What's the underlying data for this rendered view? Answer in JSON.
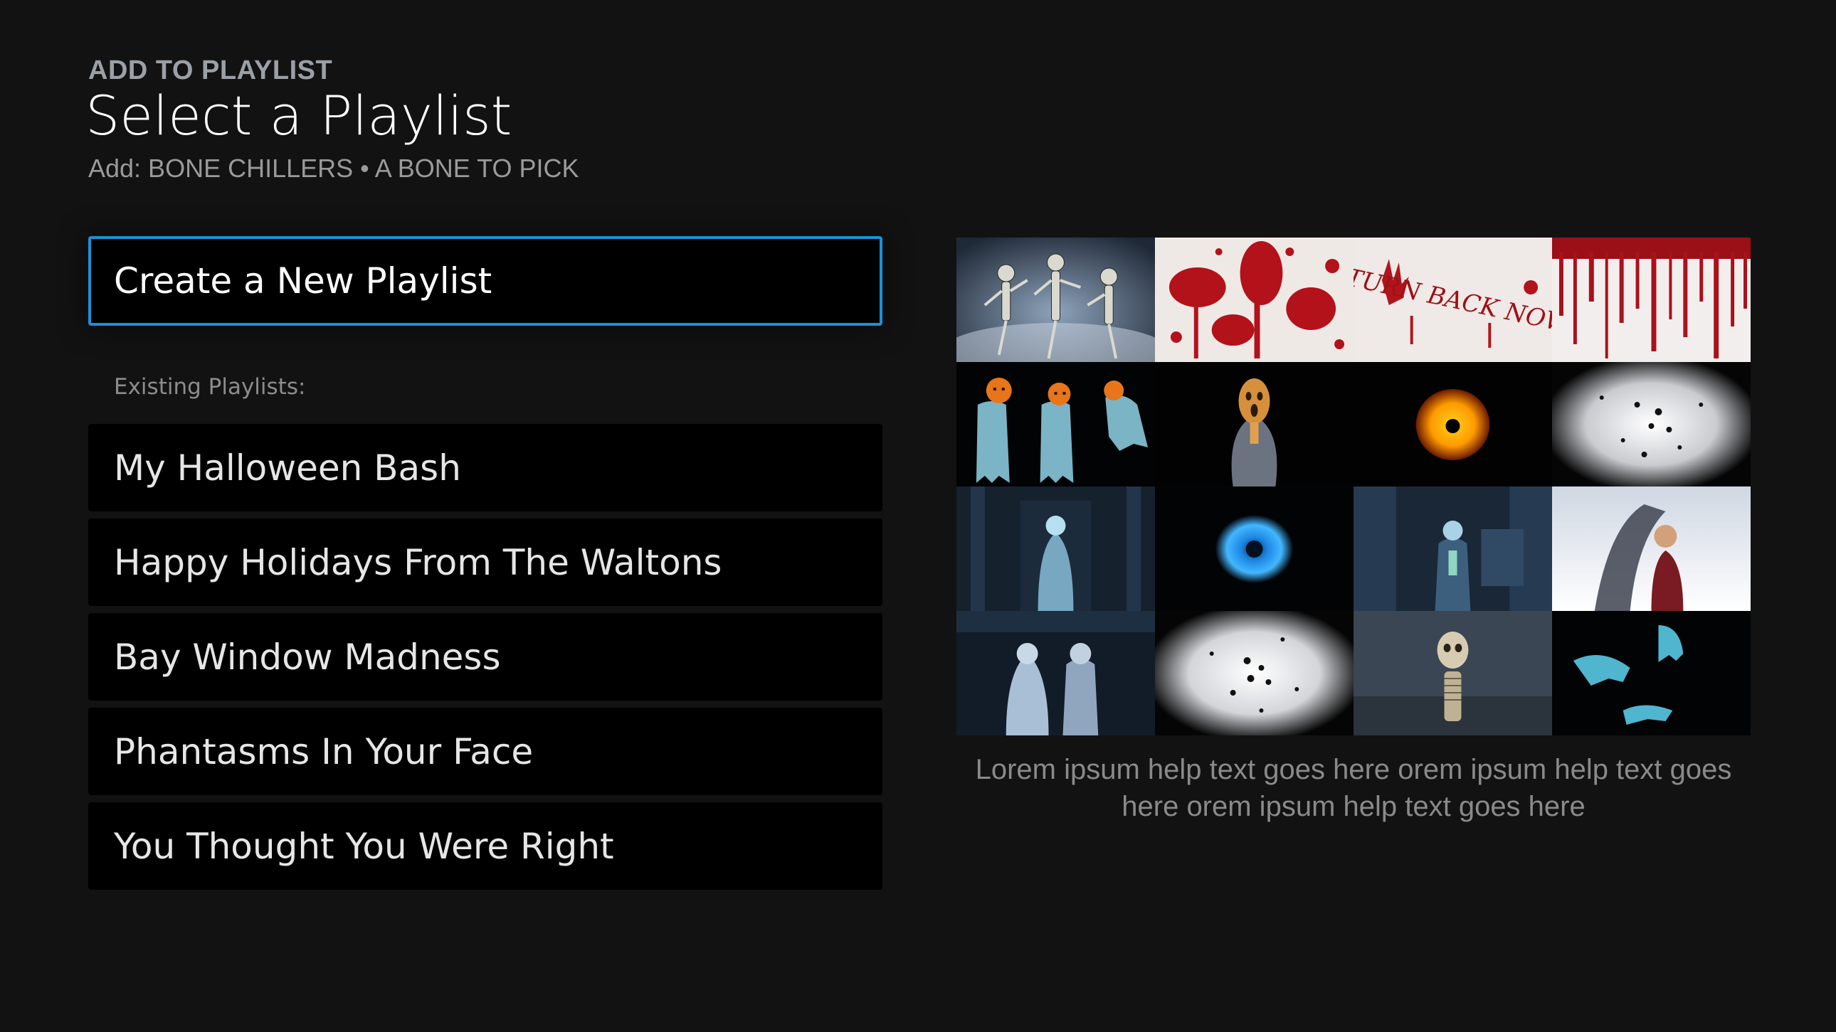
{
  "header": {
    "eyebrow": "ADD TO PLAYLIST",
    "title": "Select a Playlist",
    "subtitle": "Add: BONE CHILLERS • A BONE TO PICK"
  },
  "create_button": {
    "label": "Create a New Playlist",
    "focus_color": "#1e8fd6"
  },
  "existing": {
    "label": "Existing Playlists:",
    "items": [
      {
        "label": "My Halloween Bash"
      },
      {
        "label": "Happy Holidays From The Waltons"
      },
      {
        "label": "Bay Window Madness"
      },
      {
        "label": "Phantasms In Your Face"
      },
      {
        "label": "You Thought You Were Right"
      }
    ]
  },
  "preview": {
    "thumbnails": [
      {
        "name": "skeletons-dancing"
      },
      {
        "name": "blood-splatter"
      },
      {
        "name": "turn-back-now",
        "text": "TURN BACK NOW"
      },
      {
        "name": "blood-drips"
      },
      {
        "name": "pumpkin-ghosts"
      },
      {
        "name": "screaming-ghost"
      },
      {
        "name": "orange-eye"
      },
      {
        "name": "spiders-light"
      },
      {
        "name": "ghost-bride-hallway"
      },
      {
        "name": "blue-eye"
      },
      {
        "name": "ghost-man-room"
      },
      {
        "name": "woman-shadow"
      },
      {
        "name": "ghost-couple"
      },
      {
        "name": "spiders-light-2"
      },
      {
        "name": "skeleton-portrait"
      },
      {
        "name": "flying-ghosts"
      }
    ],
    "help_text": "Lorem ipsum help text goes here orem ipsum help text goes here orem ipsum help text goes here"
  },
  "colors": {
    "background": "#121213",
    "item_background": "#000000",
    "accent": "#1e8fd6"
  }
}
